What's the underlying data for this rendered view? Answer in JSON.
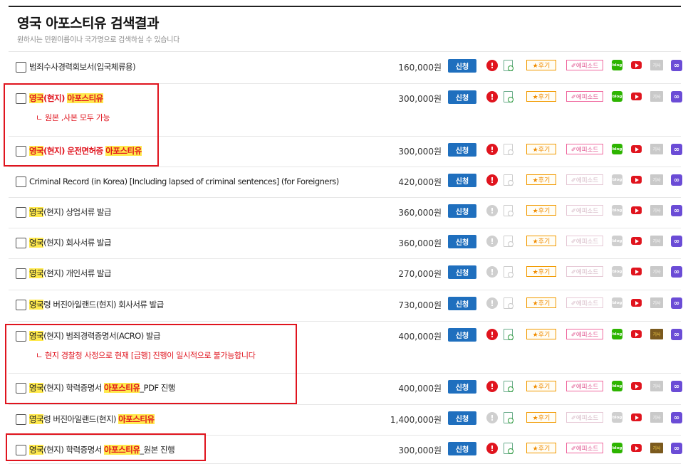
{
  "header": {
    "title": "영국 아포스티유 검색결과",
    "subtitle": "원하시는 민원이름이나 국가명으로 검색하실 수 있습니다"
  },
  "icons": {
    "apply_label": "신청",
    "alert_glyph": "!",
    "review_label": "★후기",
    "episode_label": "✐에피소드",
    "blog_label": "blog",
    "press_label": "기사",
    "link_glyph": "∞"
  },
  "rows": [
    {
      "segments": [
        {
          "text": "범죄수사경력회보서(입국체류용)",
          "style": ""
        }
      ],
      "sub": "",
      "price": "160,000원",
      "state": {
        "alert": true,
        "doc": true,
        "episode": true,
        "blog": true,
        "press": false
      }
    },
    {
      "segments": [
        {
          "text": "영국",
          "style": "red hl"
        },
        {
          "text": "(현지) ",
          "style": "red"
        },
        {
          "text": "아포스티유",
          "style": "red hl"
        }
      ],
      "sub": "ㄴ 원본 ,사본 모두 가능",
      "price": "300,000원",
      "state": {
        "alert": true,
        "doc": true,
        "episode": true,
        "blog": true,
        "press": false
      }
    },
    {
      "segments": [
        {
          "text": "영국",
          "style": "red hl"
        },
        {
          "text": "(현지) 운전면허증 ",
          "style": "red"
        },
        {
          "text": "아포스티유",
          "style": "red hl"
        }
      ],
      "sub": "",
      "price": "300,000원",
      "state": {
        "alert": true,
        "doc": false,
        "episode": true,
        "blog": true,
        "press": false
      }
    },
    {
      "segments": [
        {
          "text": "Criminal Record (in Korea) [Including lapsed of criminal sentences] (for Foreigners)",
          "style": ""
        }
      ],
      "sub": "",
      "price": "420,000원",
      "state": {
        "alert": true,
        "doc": false,
        "episode": false,
        "blog": false,
        "press": false
      }
    },
    {
      "segments": [
        {
          "text": "영국",
          "style": "hl"
        },
        {
          "text": "(현지) 상업서류 발급",
          "style": ""
        }
      ],
      "sub": "",
      "price": "360,000원",
      "state": {
        "alert": false,
        "doc": false,
        "episode": false,
        "blog": false,
        "press": false
      }
    },
    {
      "segments": [
        {
          "text": "영국",
          "style": "hl"
        },
        {
          "text": "(현지) 회사서류 발급",
          "style": ""
        }
      ],
      "sub": "",
      "price": "360,000원",
      "state": {
        "alert": false,
        "doc": false,
        "episode": false,
        "blog": false,
        "press": false
      }
    },
    {
      "segments": [
        {
          "text": "영국",
          "style": "hl"
        },
        {
          "text": "(현지) 개인서류 발급",
          "style": ""
        }
      ],
      "sub": "",
      "price": "270,000원",
      "state": {
        "alert": false,
        "doc": false,
        "episode": false,
        "blog": false,
        "press": false
      }
    },
    {
      "segments": [
        {
          "text": "영국",
          "style": "hl"
        },
        {
          "text": "령 버진아일랜드(현지) 회사서류 발급",
          "style": ""
        }
      ],
      "sub": "",
      "price": "730,000원",
      "state": {
        "alert": false,
        "doc": false,
        "episode": false,
        "blog": false,
        "press": false
      }
    },
    {
      "segments": [
        {
          "text": "영국",
          "style": "hl"
        },
        {
          "text": "(현지) 범죄경력증명서(ACRO) 발급",
          "style": ""
        }
      ],
      "sub": "ㄴ 현지 경찰청 사정으로 현재 [급행] 진행이 일시적으로 불가능합니다",
      "price": "400,000원",
      "state": {
        "alert": true,
        "doc": true,
        "episode": true,
        "blog": true,
        "press": true
      }
    },
    {
      "segments": [
        {
          "text": "영국",
          "style": "hl"
        },
        {
          "text": "(현지) 학력증명서 ",
          "style": ""
        },
        {
          "text": "아포스티유",
          "style": "red hl"
        },
        {
          "text": "_PDF 진행",
          "style": ""
        }
      ],
      "sub": "",
      "price": "400,000원",
      "state": {
        "alert": true,
        "doc": true,
        "episode": true,
        "blog": true,
        "press": false
      }
    },
    {
      "segments": [
        {
          "text": "영국",
          "style": "hl"
        },
        {
          "text": "령 버진아일랜드(현지) ",
          "style": ""
        },
        {
          "text": "아포스티유",
          "style": "red hl"
        }
      ],
      "sub": "",
      "price": "1,400,000원",
      "state": {
        "alert": false,
        "doc": true,
        "episode": false,
        "blog": false,
        "press": false
      }
    },
    {
      "segments": [
        {
          "text": "영국",
          "style": "hl"
        },
        {
          "text": "(현지) 학력증명서 ",
          "style": ""
        },
        {
          "text": "아포스티유",
          "style": "red hl"
        },
        {
          "text": "_원본 진행",
          "style": ""
        }
      ],
      "sub": "",
      "price": "300,000원",
      "state": {
        "alert": true,
        "doc": true,
        "episode": true,
        "blog": true,
        "press": true
      }
    }
  ]
}
